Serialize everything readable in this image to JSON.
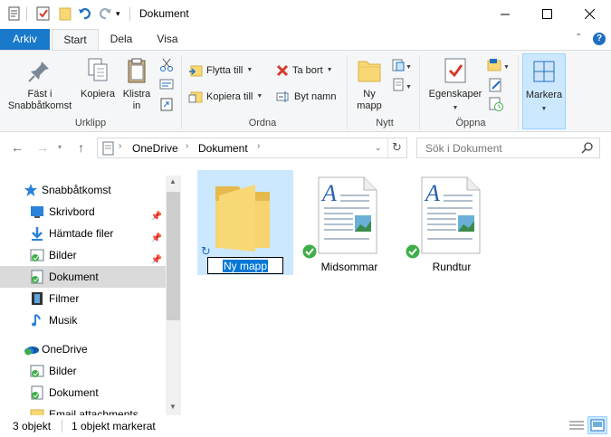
{
  "window": {
    "title": "Dokument"
  },
  "tabs": {
    "file": "Arkiv",
    "start": "Start",
    "share": "Dela",
    "view": "Visa"
  },
  "ribbon": {
    "clipboard": {
      "pin_label_1": "Fäst i",
      "pin_label_2": "Snabbåtkomst",
      "copy": "Kopiera",
      "paste_1": "Klistra",
      "paste_2": "in",
      "group": "Urklipp"
    },
    "organize": {
      "move_to": "Flytta till",
      "copy_to": "Kopiera till",
      "delete": "Ta bort",
      "rename": "Byt namn",
      "group": "Ordna"
    },
    "new": {
      "new_folder_1": "Ny",
      "new_folder_2": "mapp",
      "group": "Nytt"
    },
    "open": {
      "properties": "Egenskaper",
      "group": "Öppna"
    },
    "select": {
      "select": "Markera"
    }
  },
  "address": {
    "crumbs": [
      "OneDrive",
      "Dokument"
    ]
  },
  "search": {
    "placeholder": "Sök i Dokument"
  },
  "sidebar": {
    "items": [
      {
        "label": "Snabbåtkomst",
        "icon": "star-icon"
      },
      {
        "label": "Skrivbord",
        "icon": "desktop-icon"
      },
      {
        "label": "Hämtade filer",
        "icon": "download-icon"
      },
      {
        "label": "Bilder",
        "icon": "pictures-icon"
      },
      {
        "label": "Dokument",
        "icon": "documents-icon"
      },
      {
        "label": "Filmer",
        "icon": "film-icon"
      },
      {
        "label": "Musik",
        "icon": "music-icon"
      },
      {
        "label": "OneDrive",
        "icon": "onedrive-icon"
      },
      {
        "label": "Bilder",
        "icon": "pictures-icon"
      },
      {
        "label": "Dokument",
        "icon": "documents-icon"
      },
      {
        "label": "Email attachments",
        "icon": "folder-icon"
      }
    ]
  },
  "files": [
    {
      "name": "Ny mapp",
      "type": "folder"
    },
    {
      "name": "Midsommar",
      "type": "document"
    },
    {
      "name": "Rundtur",
      "type": "document"
    }
  ],
  "status": {
    "count": "3 objekt",
    "selected": "1 objekt markerat"
  },
  "colors": {
    "accent": "#1979ca",
    "selection": "#cce8ff",
    "folder": "#f8d775",
    "sync_green": "#3fae49"
  }
}
